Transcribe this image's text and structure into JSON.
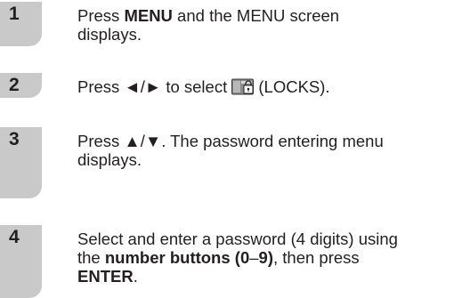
{
  "steps": [
    {
      "number": "1",
      "parts": {
        "a": "Press ",
        "b": "MENU",
        "c": " and the MENU screen",
        "d": "displays."
      }
    },
    {
      "number": "2",
      "parts": {
        "a": "Press ◄/► to select ",
        "icon": "locks-icon",
        "b": "(LOCKS)."
      }
    },
    {
      "number": "3",
      "parts": {
        "a": "Press ▲/▼. The password entering menu",
        "b": "displays."
      }
    },
    {
      "number": "4",
      "parts": {
        "a": "Select and enter a password (4 digits) using",
        "b": "the ",
        "c": "number buttons (0",
        "d": "–",
        "e": "9)",
        "f": ", then press",
        "g": "ENTER",
        "h": "."
      }
    }
  ]
}
